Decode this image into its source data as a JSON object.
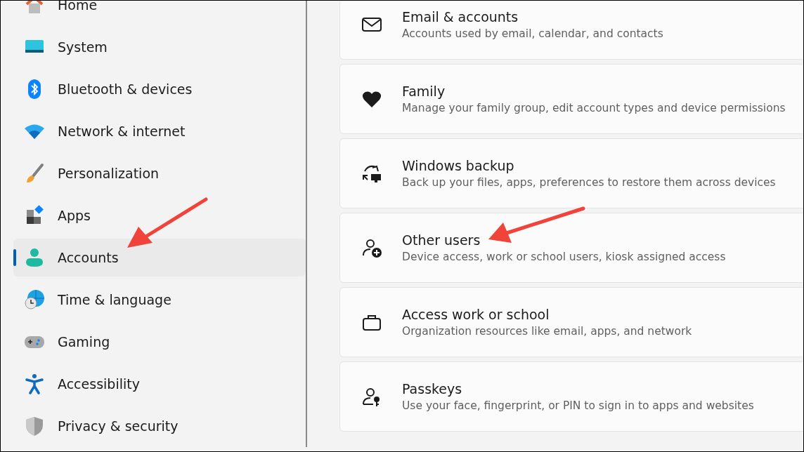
{
  "sidebar": {
    "items": [
      {
        "label": "Home",
        "selected": false
      },
      {
        "label": "System",
        "selected": false
      },
      {
        "label": "Bluetooth & devices",
        "selected": false
      },
      {
        "label": "Network & internet",
        "selected": false
      },
      {
        "label": "Personalization",
        "selected": false
      },
      {
        "label": "Apps",
        "selected": false
      },
      {
        "label": "Accounts",
        "selected": true
      },
      {
        "label": "Time & language",
        "selected": false
      },
      {
        "label": "Gaming",
        "selected": false
      },
      {
        "label": "Accessibility",
        "selected": false
      },
      {
        "label": "Privacy & security",
        "selected": false
      }
    ]
  },
  "cards": [
    {
      "title": "Email & accounts",
      "description": "Accounts used by email, calendar, and contacts"
    },
    {
      "title": "Family",
      "description": "Manage your family group, edit account types and device permissions"
    },
    {
      "title": "Windows backup",
      "description": "Back up your files, apps, preferences to restore them across devices"
    },
    {
      "title": "Other users",
      "description": "Device access, work or school users, kiosk assigned access"
    },
    {
      "title": "Access work or school",
      "description": "Organization resources like email, apps, and network"
    },
    {
      "title": "Passkeys",
      "description": "Use your face, fingerprint, or PIN to sign in to apps and websites"
    }
  ]
}
